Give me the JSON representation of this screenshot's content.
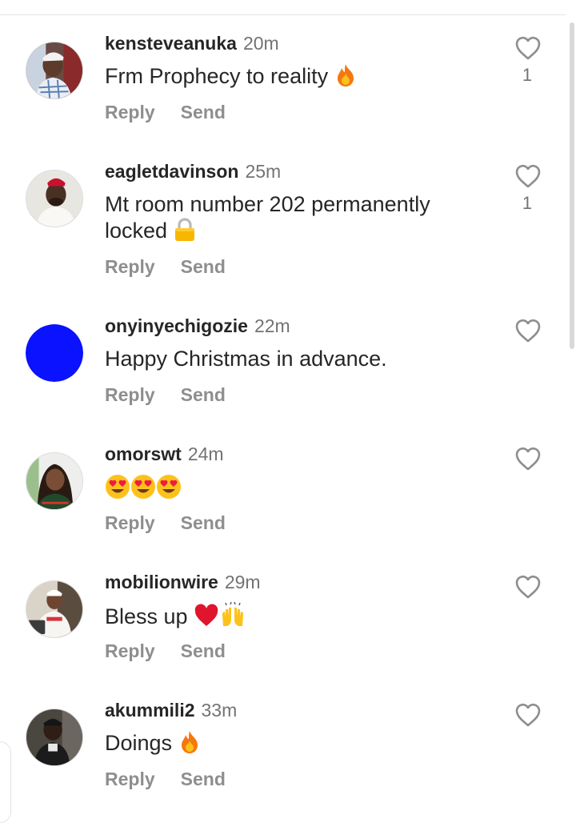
{
  "comments": [
    {
      "username": "kensteveanuka",
      "time": "20m",
      "text": "Frm Prophecy to reality",
      "likes": "1",
      "avatar": "man-white-shirt-photo"
    },
    {
      "username": "eagletdavinson",
      "time": "25m",
      "text": "Mt room number 202 permanently locked",
      "likes": "1",
      "avatar": "man-red-cap-photo"
    },
    {
      "username": "onyinyechigozie",
      "time": "22m",
      "text": "Happy Christmas in advance.",
      "likes": "",
      "avatar": "solid-blue-circle",
      "avatar_color": "#0a12ff"
    },
    {
      "username": "omorswt",
      "time": "24m",
      "text": "",
      "likes": "",
      "avatar": "woman-photo"
    },
    {
      "username": "mobilionwire",
      "time": "29m",
      "text": "Bless up",
      "likes": "",
      "avatar": "man-seated-photo"
    },
    {
      "username": "akummili2",
      "time": "33m",
      "text": "Doings",
      "likes": "",
      "avatar": "man-dark-photo"
    }
  ],
  "actions": {
    "reply": "Reply",
    "send": "Send"
  },
  "icons": {
    "like": "heart-outline-icon",
    "fire": "fire-emoji",
    "lock": "lock-emoji",
    "heart_eyes": "heart-eyes-emoji",
    "red_heart": "red-heart-emoji",
    "raised_hands": "raised-hands-emoji"
  },
  "colors": {
    "text": "#262626",
    "meta": "#737373",
    "action": "#8e8e8e",
    "divider": "#e3e3e3"
  }
}
